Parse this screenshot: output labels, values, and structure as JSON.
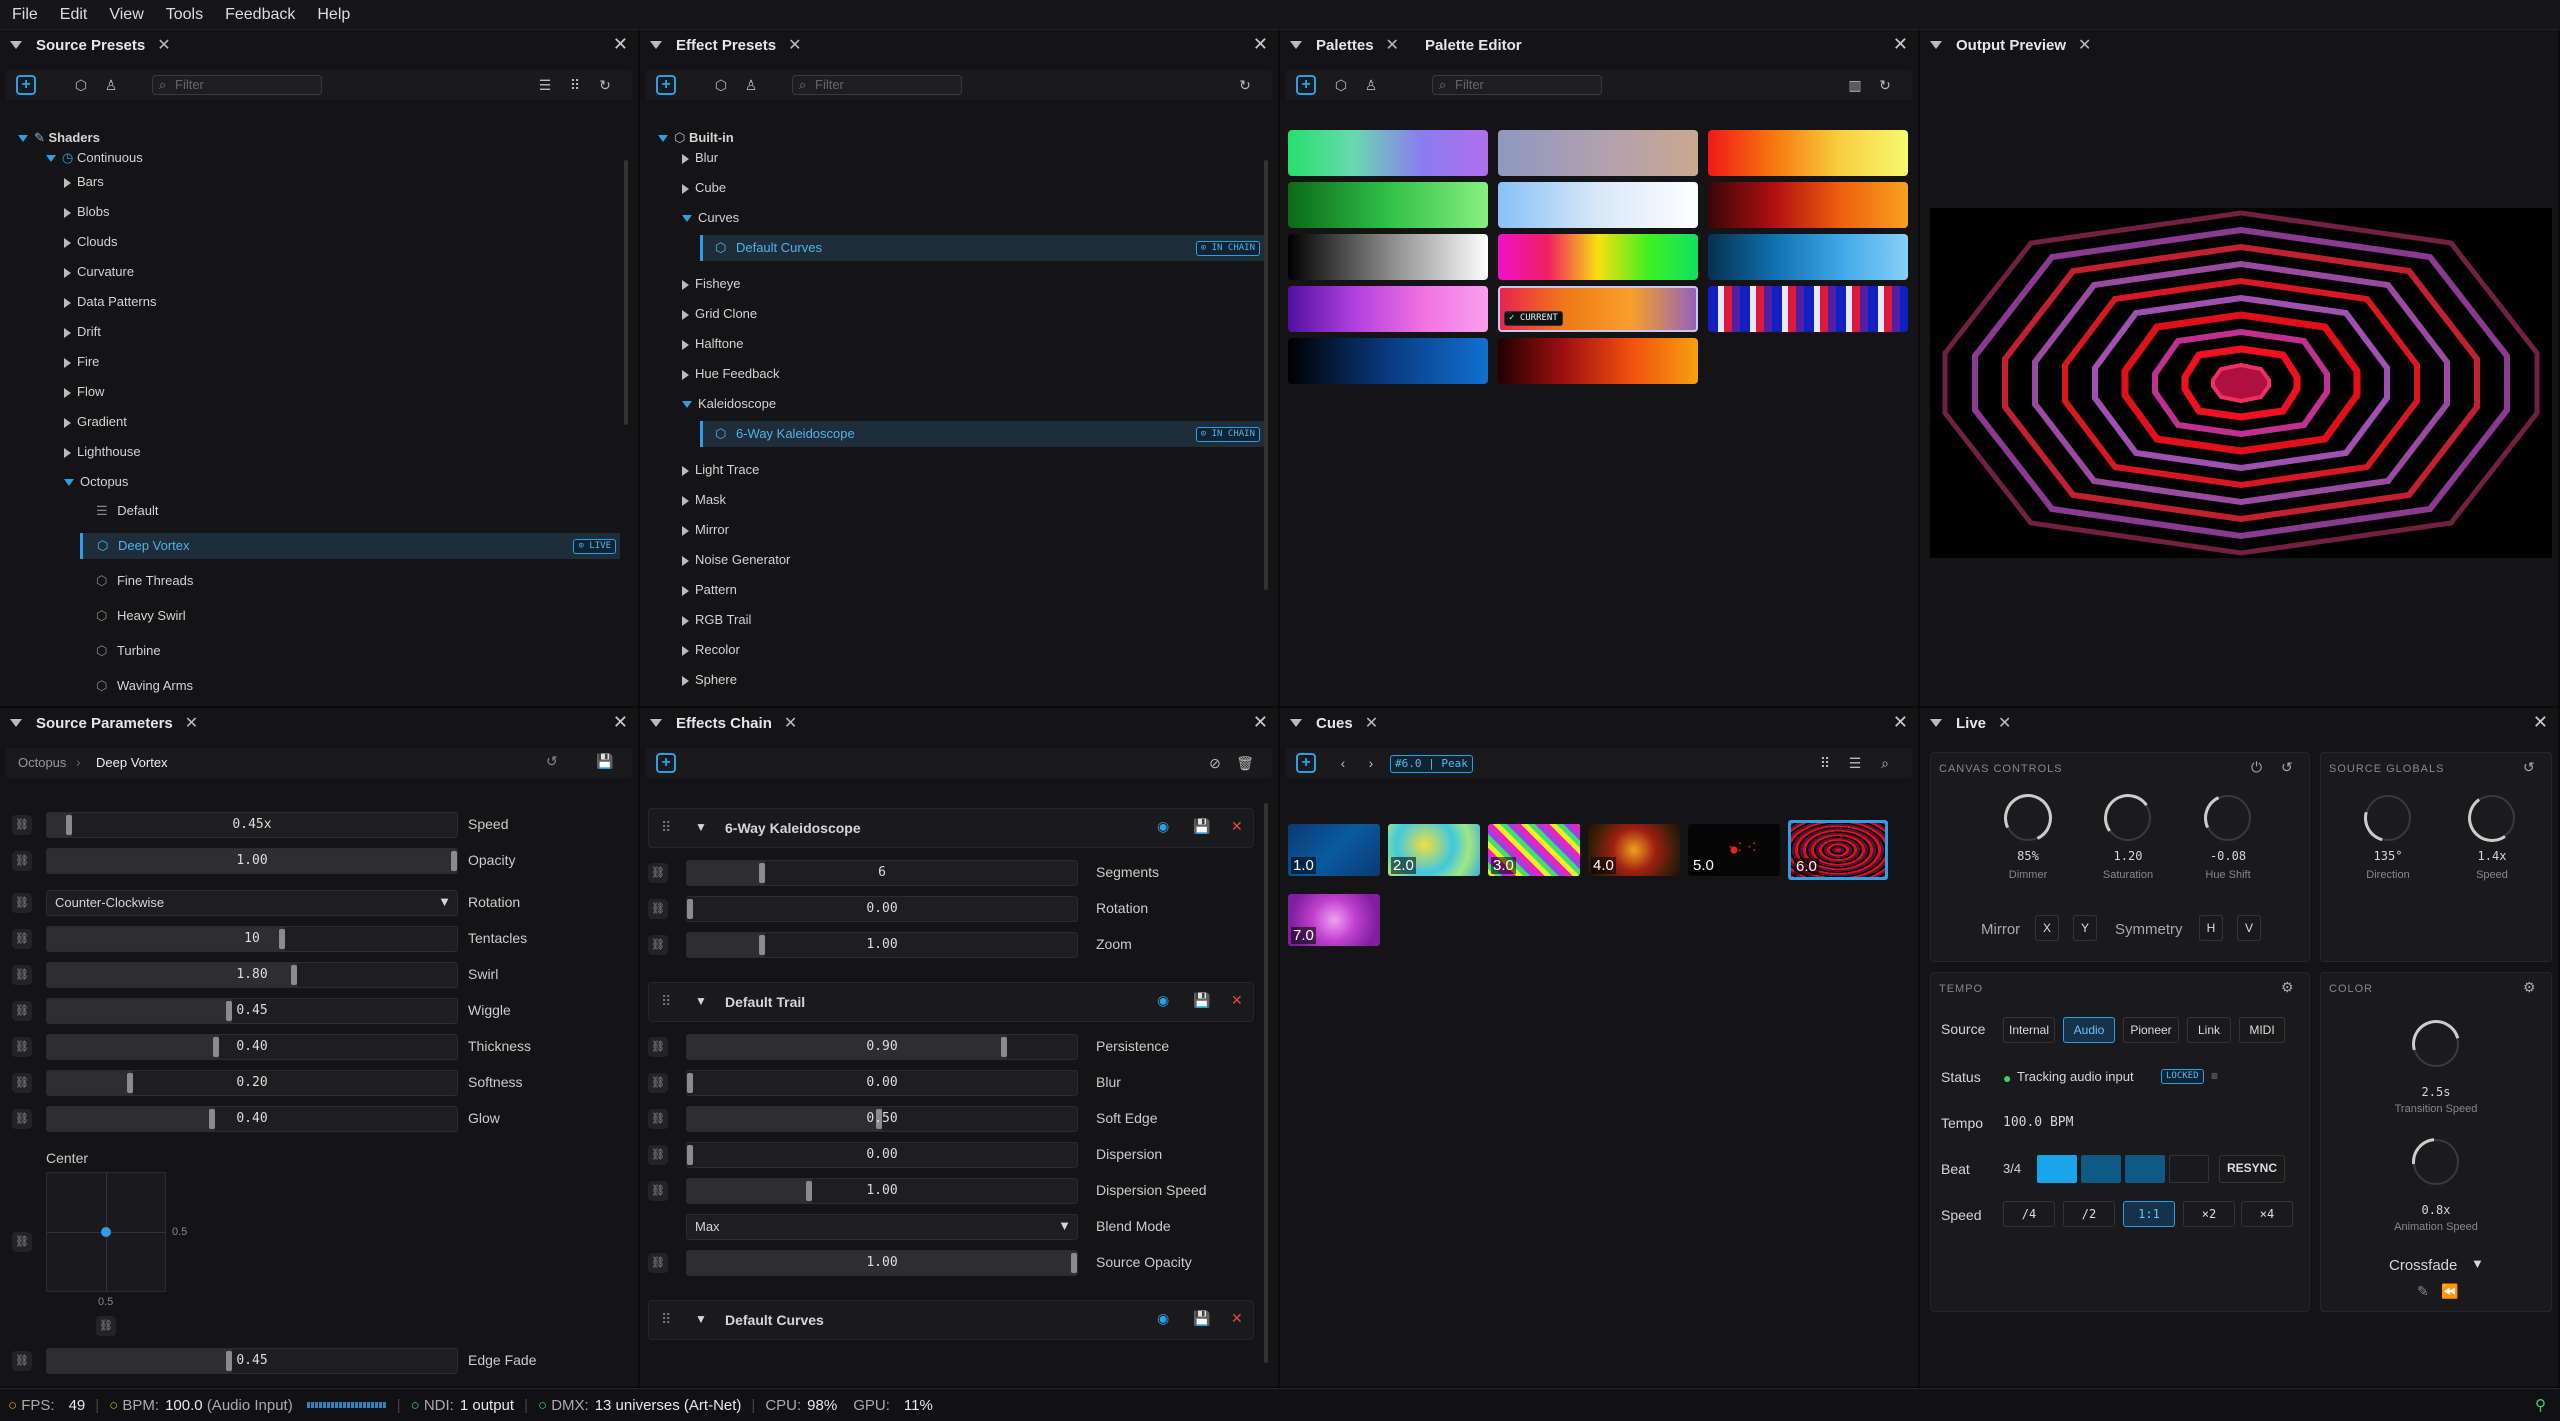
{
  "menu": [
    "File",
    "Edit",
    "View",
    "Tools",
    "Feedback",
    "Help"
  ],
  "panels": {
    "source_presets": {
      "title": "Source Presets",
      "filter": "Filter"
    },
    "effect_presets": {
      "title": "Effect Presets",
      "filter": "Filter"
    },
    "palettes": {
      "title": "Palettes",
      "title2": "Palette Editor",
      "filter": "Filter"
    },
    "output": {
      "title": "Output Preview"
    },
    "source_params": {
      "title": "Source Parameters"
    },
    "effects_chain": {
      "title": "Effects Chain"
    },
    "cues": {
      "title": "Cues"
    },
    "live": {
      "title": "Live"
    }
  },
  "source_tree": {
    "root": "Shaders",
    "group": "Continuous",
    "items": [
      "Bars",
      "Blobs",
      "Clouds",
      "Curvature",
      "Data Patterns",
      "Drift",
      "Fire",
      "Flow",
      "Gradient",
      "Lighthouse"
    ],
    "open": "Octopus",
    "children": [
      "Default",
      "Deep Vortex",
      "Fine Threads",
      "Heavy Swirl",
      "Turbine",
      "Waving Arms"
    ],
    "live_badge": "LIVE"
  },
  "effect_tree": {
    "root": "Built-in",
    "items": [
      "Blur",
      "Cube",
      "Curves",
      "Default Curves",
      "Fisheye",
      "Grid Clone",
      "Halftone",
      "Hue Feedback",
      "Kaleidoscope",
      "6-Way Kaleidoscope",
      "Light Trace",
      "Mask",
      "Mirror",
      "Noise Generator",
      "Pattern",
      "RGB Trail",
      "Recolor",
      "Sphere"
    ],
    "chain_badge": "IN CHAIN"
  },
  "palettes": {
    "current_badge": "✓ CURRENT"
  },
  "source_params": {
    "breadcrumb_parent": "Octopus",
    "breadcrumb_current": "Deep Vortex",
    "params": [
      {
        "label": "Speed",
        "value": "0.45x",
        "frac": 0.06
      },
      {
        "label": "Opacity",
        "value": "1.00",
        "frac": 1.0
      },
      {
        "label": "Rotation",
        "value": "Counter-Clockwise",
        "frac": null
      },
      {
        "label": "Tentacles",
        "value": "10",
        "frac": 0.58
      },
      {
        "label": "Swirl",
        "value": "1.80",
        "frac": 0.61
      },
      {
        "label": "Wiggle",
        "value": "0.45",
        "frac": 0.45
      },
      {
        "label": "Thickness",
        "value": "0.40",
        "frac": 0.42
      },
      {
        "label": "Softness",
        "value": "0.20",
        "frac": 0.21
      },
      {
        "label": "Glow",
        "value": "0.40",
        "frac": 0.41
      }
    ],
    "center_label": "Center",
    "center_x": "0.5",
    "center_y": "0.5",
    "edge_fade": {
      "label": "Edge Fade",
      "value": "0.45",
      "frac": 0.45
    }
  },
  "effects_chain": {
    "sections": [
      {
        "title": "6-Way Kaleidoscope",
        "params": [
          {
            "label": "Segments",
            "value": "6",
            "frac": 0.2
          },
          {
            "label": "Rotation",
            "value": "0.00",
            "frac": 0.0
          },
          {
            "label": "Zoom",
            "value": "1.00",
            "frac": 0.2
          }
        ]
      },
      {
        "title": "Default Trail",
        "params": [
          {
            "label": "Persistence",
            "value": "0.90",
            "frac": 0.82
          },
          {
            "label": "Blur",
            "value": "0.00",
            "frac": 0.0
          },
          {
            "label": "Soft Edge",
            "value": "0.50",
            "frac": 0.5
          },
          {
            "label": "Dispersion",
            "value": "0.00",
            "frac": 0.0
          },
          {
            "label": "Dispersion Speed",
            "value": "1.00",
            "frac": 0.32
          },
          {
            "label": "Blend Mode",
            "value": "Max",
            "frac": null
          },
          {
            "label": "Source Opacity",
            "value": "1.00",
            "frac": 1.0
          }
        ]
      },
      {
        "title": "Default Curves",
        "params": []
      }
    ]
  },
  "cues": {
    "tag": "#6.0 | Peak",
    "items": [
      "1.0",
      "2.0",
      "3.0",
      "4.0",
      "5.0",
      "6.0",
      "7.0"
    ]
  },
  "live": {
    "canvas_title": "CANVAS CONTROLS",
    "globals_title": "SOURCE GLOBALS",
    "knobs": [
      {
        "value": "85%",
        "label": "Dimmer"
      },
      {
        "value": "1.20",
        "label": "Saturation"
      },
      {
        "value": "-0.08",
        "label": "Hue Shift"
      }
    ],
    "gknobs": [
      {
        "value": "135°",
        "label": "Direction"
      },
      {
        "value": "1.4x",
        "label": "Speed"
      }
    ],
    "mirror": "Mirror",
    "symmetry": "Symmetry",
    "tempo_title": "TEMPO",
    "color_title": "COLOR",
    "source_label": "Source",
    "sources": [
      "Internal",
      "Audio",
      "Pioneer",
      "Link",
      "MIDI"
    ],
    "status_label": "Status",
    "status_value": "Tracking audio input",
    "locked": "LOCKED",
    "tempo_label": "Tempo",
    "tempo_value": "100.0 BPM",
    "beat_label": "Beat",
    "beat_value": "3/4",
    "resync": "RESYNC",
    "speed_label": "Speed",
    "speeds": [
      "/4",
      "/2",
      "1:1",
      "×2",
      "×4"
    ],
    "transition": {
      "value": "2.5s",
      "label": "Transition Speed"
    },
    "animation": {
      "value": "0.8x",
      "label": "Animation Speed"
    },
    "crossfade": "Crossfade"
  },
  "status": {
    "fps_label": "FPS:",
    "fps": "49",
    "bpm_label": "BPM:",
    "bpm": "100.0",
    "bpm_src": "(Audio Input)",
    "ndi_label": "NDI:",
    "ndi": "1 output",
    "dmx_label": "DMX:",
    "dmx": "13 universes (Art-Net)",
    "cpu_label": "CPU:",
    "cpu": "98%",
    "gpu_label": "GPU:",
    "gpu": "11%"
  }
}
